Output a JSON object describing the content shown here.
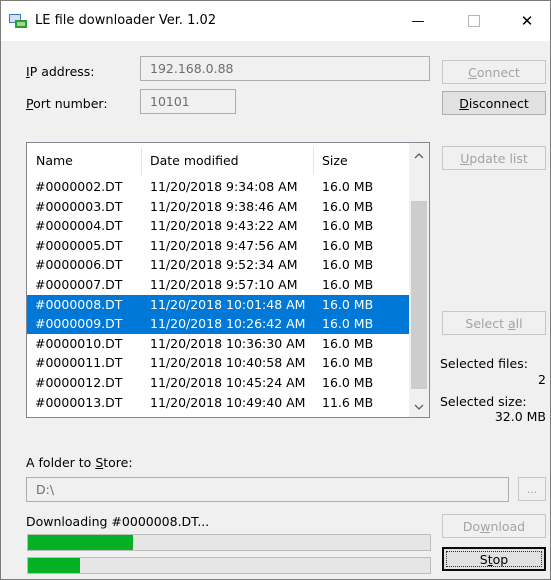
{
  "window": {
    "title": "LE file downloader Ver. 1.02",
    "minimize_glyph": "—",
    "close_glyph": "✕"
  },
  "connection": {
    "ip_label_prefix": "I",
    "ip_label_rest": "P address:",
    "ip_value": "192.168.0.88",
    "port_label_prefix": "P",
    "port_label_rest": "ort number:",
    "port_value": "10101",
    "connect_prefix": "C",
    "connect_rest": "onnect",
    "disconnect_prefix": "D",
    "disconnect_rest": "isconnect"
  },
  "file_list": {
    "columns": [
      "Name",
      "Date modified",
      "Size"
    ],
    "rows": [
      {
        "name": "#0000002.DT",
        "date": "11/20/2018 9:34:08 AM",
        "size": "16.0 MB",
        "selected": false
      },
      {
        "name": "#0000003.DT",
        "date": "11/20/2018 9:38:46 AM",
        "size": "16.0 MB",
        "selected": false
      },
      {
        "name": "#0000004.DT",
        "date": "11/20/2018 9:43:22 AM",
        "size": "16.0 MB",
        "selected": false
      },
      {
        "name": "#0000005.DT",
        "date": "11/20/2018 9:47:56 AM",
        "size": "16.0 MB",
        "selected": false
      },
      {
        "name": "#0000006.DT",
        "date": "11/20/2018 9:52:34 AM",
        "size": "16.0 MB",
        "selected": false
      },
      {
        "name": "#0000007.DT",
        "date": "11/20/2018 9:57:10 AM",
        "size": "16.0 MB",
        "selected": false
      },
      {
        "name": "#0000008.DT",
        "date": "11/20/2018 10:01:48 AM",
        "size": "16.0 MB",
        "selected": true
      },
      {
        "name": "#0000009.DT",
        "date": "11/20/2018 10:26:42 AM",
        "size": "16.0 MB",
        "selected": true
      },
      {
        "name": "#0000010.DT",
        "date": "11/20/2018 10:36:30 AM",
        "size": "16.0 MB",
        "selected": false
      },
      {
        "name": "#0000011.DT",
        "date": "11/20/2018 10:40:58 AM",
        "size": "16.0 MB",
        "selected": false
      },
      {
        "name": "#0000012.DT",
        "date": "11/20/2018 10:45:24 AM",
        "size": "16.0 MB",
        "selected": false
      },
      {
        "name": "#0000013.DT",
        "date": "11/20/2018 10:49:40 AM",
        "size": "11.6 MB",
        "selected": false
      }
    ]
  },
  "side": {
    "update_prefix": "U",
    "update_rest": "pdate list",
    "select_all_main": "Select ",
    "select_all_accel": "a",
    "select_all_rest": "ll",
    "selected_files_label": "Selected files:",
    "selected_files_value": "2",
    "selected_size_label": "Selected size:",
    "selected_size_value": "32.0 MB"
  },
  "store": {
    "label_main": "A folder to ",
    "label_accel": "S",
    "label_rest": "tore:",
    "path": "D:\\",
    "browse_label": "..."
  },
  "download": {
    "status": "Downloading #0000008.DT...",
    "file_progress": 0.26,
    "total_progress": 0.13,
    "download_main": "Do",
    "download_accel": "w",
    "download_rest": "nload",
    "stop_main": "S",
    "stop_accel": "t",
    "stop_rest": "op"
  },
  "colors": {
    "selection": "#0078d7",
    "progress_fill": "#06b025"
  }
}
